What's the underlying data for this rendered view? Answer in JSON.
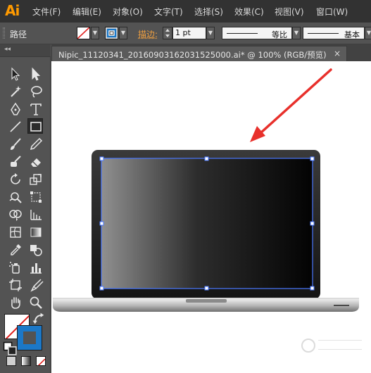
{
  "app": {
    "logo": "Ai"
  },
  "menu": [
    "文件(F)",
    "编辑(E)",
    "对象(O)",
    "文字(T)",
    "选择(S)",
    "效果(C)",
    "视图(V)",
    "窗口(W)"
  ],
  "control": {
    "selection_label": "路径",
    "stroke_label": "描边:",
    "stroke_weight": "1 pt",
    "profile_label": "等比",
    "brush_label": "基本"
  },
  "document": {
    "tab_title": "Nipic_11120341_20160903162031525000.ai*  @  100%  (RGB/预览)",
    "close": "×"
  },
  "toolbar": {
    "collapse": "◂◂",
    "tools": [
      "selection-tool-icon",
      "direct-selection-tool-icon",
      "magic-wand-tool-icon",
      "lasso-tool-icon",
      "pen-tool-icon",
      "type-tool-icon",
      "line-tool-icon",
      "rectangle-tool-icon",
      "paintbrush-tool-icon",
      "pencil-tool-icon",
      "blob-brush-tool-icon",
      "eraser-tool-icon",
      "rotate-tool-icon",
      "scale-tool-icon",
      "warp-tool-icon",
      "free-transform-tool-icon",
      "shape-builder-tool-icon",
      "perspective-grid-tool-icon",
      "mesh-tool-icon",
      "gradient-tool-icon",
      "eyedropper-tool-icon",
      "blend-tool-icon",
      "symbol-sprayer-tool-icon",
      "column-graph-tool-icon",
      "artboard-tool-icon",
      "slice-tool-icon",
      "hand-tool-icon",
      "zoom-tool-icon"
    ],
    "active_tool": "rectangle-tool-icon"
  },
  "colors": {
    "accent_orange": "#ff9a00",
    "stroke_blue": "#1c78c7",
    "selection_blue": "#4a78ff",
    "arrow_red": "#e8302b"
  }
}
